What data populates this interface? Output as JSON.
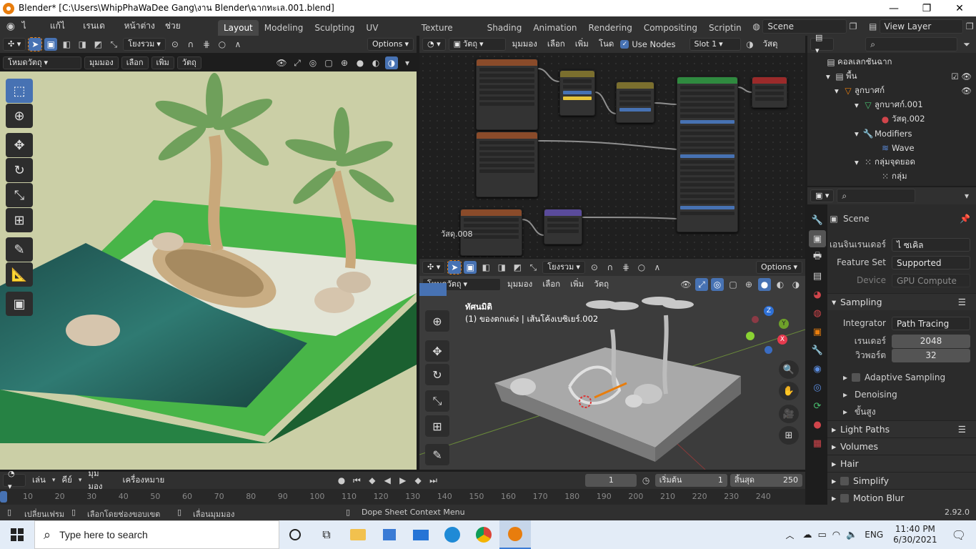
{
  "window": {
    "title": "Blender* [C:\\Users\\WhipPhaWaDee Gang\\งาน Blender\\ฉากทะเล.001.blend]",
    "minimize": "—",
    "maximize": "❐",
    "close": "✕"
  },
  "menu": [
    "ไ ฟล์",
    "แก้ไ ข",
    "เรนเดอร์",
    "หน้าต่าง",
    "ช่วยเหลือ"
  ],
  "workspaces": [
    "Layout",
    "Modeling",
    "Sculpting",
    "UV Editing",
    "Texture Paint",
    "Shading",
    "Animation",
    "Rendering",
    "Compositing",
    "Scriptin"
  ],
  "active_workspace": "Layout",
  "scene": "Scene",
  "view_layer": "View Layer",
  "vp1": {
    "mode": "โยงรวม",
    "options": "Options",
    "object_mode": "โหมดวัตถุ",
    "menus": [
      "มุมมอง",
      "เลือก",
      "เพิ่ม",
      "วัตถุ"
    ]
  },
  "node_editor": {
    "object": "วัตถุ",
    "menus": [
      "มุมมอง",
      "เลือก",
      "เพิ่ม",
      "โนด"
    ],
    "use_nodes": "Use Nodes",
    "slot": "Slot 1",
    "material_label": "วัสดุ",
    "material_name": "วัสดุ.008"
  },
  "vp2": {
    "mode": "โยงรวม",
    "options": "Options",
    "object_mode": "โหมดวัตถุ",
    "menus": [
      "มุมมอง",
      "เลือก",
      "เพิ่ม",
      "วัตถุ"
    ],
    "view_name": "ทัศนมิติ",
    "view_info": "(1) ของตกแต่ง | เส้นโค้งเบซิเยร์.002"
  },
  "outliner": {
    "rows": [
      {
        "label": "คอลเลกชันฉาก",
        "indent": 0
      },
      {
        "label": "พื้น",
        "indent": 1
      },
      {
        "label": "ลูกบาศก์",
        "indent": 2
      },
      {
        "label": "ลูกบาศก์.001",
        "indent": 3
      },
      {
        "label": "วัสดุ.002",
        "indent": 4
      },
      {
        "label": "Modifiers",
        "indent": 3
      },
      {
        "label": "Wave",
        "indent": 4
      },
      {
        "label": "กลุ่มจุดยอด",
        "indent": 3
      },
      {
        "label": "กลุ่ม",
        "indent": 4
      }
    ]
  },
  "properties": {
    "scene_label": "Scene",
    "render_engine_label": "เอนจินเรนเดอร์",
    "render_engine": "ไ ซเคิล",
    "feature_set_label": "Feature Set",
    "feature_set": "Supported",
    "device_label": "Device",
    "device": "GPU Compute",
    "sampling": "Sampling",
    "integrator_label": "Integrator",
    "integrator": "Path Tracing",
    "render_label": "เรนเดอร์",
    "render_samples": "2048",
    "viewport_label": "วิวพอร์ต",
    "viewport_samples": "32",
    "adaptive": "Adaptive Sampling",
    "denoising": "Denoising",
    "advanced": "ขั้นสูง",
    "light_paths": "Light Paths",
    "volumes": "Volumes",
    "hair": "Hair",
    "simplify": "Simplify",
    "motion_blur": "Motion Blur"
  },
  "timeline": {
    "menus": [
      "เล่น",
      "คีย์",
      "มุมมอง",
      "เครื่องหมาย"
    ],
    "current_frame": "1",
    "start_label": "เริ่มต้น",
    "start": "1",
    "end_label": "สิ้นสุด",
    "end": "250",
    "ticks": [
      "10",
      "20",
      "30",
      "40",
      "50",
      "60",
      "70",
      "80",
      "90",
      "100",
      "110",
      "120",
      "130",
      "140",
      "150",
      "160",
      "170",
      "180",
      "190",
      "200",
      "210",
      "220",
      "230",
      "240"
    ]
  },
  "status": {
    "left1": "เปลี่ยนเฟรม",
    "left2": "เลือกโดยช่องขอบเขต",
    "left3": "เลื่อนมุมมอง",
    "center": "Dope Sheet Context Menu",
    "version": "2.92.0"
  },
  "taskbar": {
    "search_placeholder": "Type here to search",
    "lang": "ENG",
    "time": "11:40 PM",
    "date": "6/30/2021"
  }
}
